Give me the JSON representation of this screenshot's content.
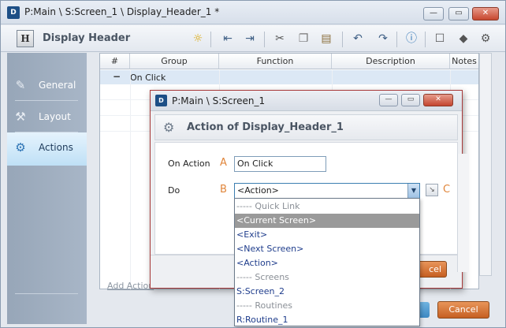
{
  "window": {
    "app_icon": "D",
    "title": "P:Main \\ S:Screen_1 \\ Display_Header_1 *",
    "minimize": "—",
    "maximize": "▭",
    "close": "✕"
  },
  "toolbar": {
    "icon_letter": "H",
    "title": "Display Header"
  },
  "nav": {
    "items": [
      {
        "label": "General",
        "icon": "pencil-icon"
      },
      {
        "label": "Layout",
        "icon": "wrench-icon"
      },
      {
        "label": "Actions",
        "icon": "gears-icon"
      }
    ]
  },
  "grid": {
    "columns": [
      "#",
      "Group",
      "Function",
      "Description",
      "Notes"
    ],
    "group_toggle": "−",
    "group_label": "On Click",
    "add_action": "Add Action"
  },
  "buttons": {
    "cancel": "Cancel"
  },
  "dialog": {
    "app_icon": "D",
    "title": "P:Main \\ S:Screen_1",
    "heading": "Action of Display_Header_1",
    "on_action_label": "On Action",
    "on_action_letter": "A",
    "on_action_value": "On Click",
    "do_label": "Do",
    "do_letter": "B",
    "do_value": "<Action>",
    "c_letter": "C",
    "cancel_fragment": "cel"
  },
  "dropdown": {
    "items": [
      {
        "label": "----- Quick Link",
        "type": "header"
      },
      {
        "label": "<Current Screen>",
        "type": "selected"
      },
      {
        "label": "<Exit>",
        "type": "item"
      },
      {
        "label": "<Next Screen>",
        "type": "item"
      },
      {
        "label": "<Action>",
        "type": "item"
      },
      {
        "label": "----- Screens",
        "type": "header"
      },
      {
        "label": "S:Screen_2",
        "type": "item"
      },
      {
        "label": "----- Routines",
        "type": "header"
      },
      {
        "label": "R:Routine_1",
        "type": "item"
      }
    ]
  },
  "colors": {
    "accent_orange": "#e0853a",
    "selection_gray": "#9a9a9a",
    "nav_active": "#cfe8f9"
  }
}
